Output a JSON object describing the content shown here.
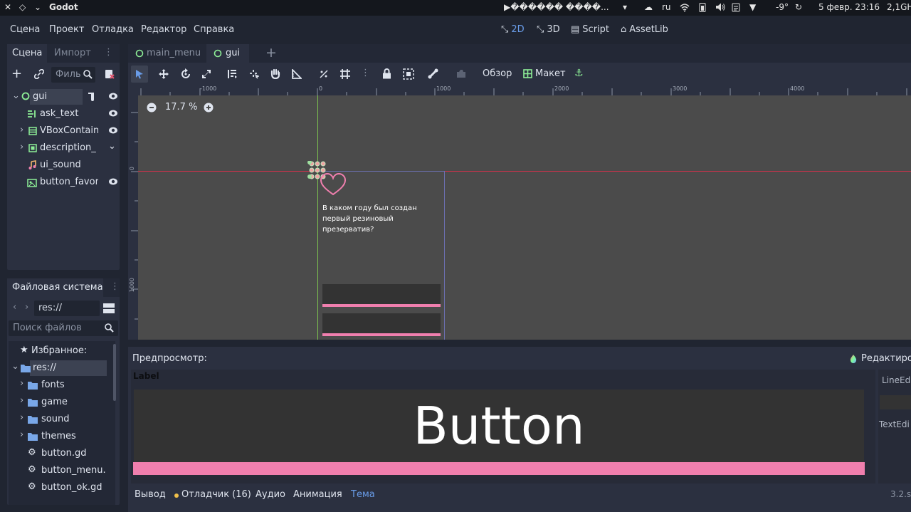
{
  "sysbar": {
    "app_name": "Godot",
    "player_text": "▶������ ����...",
    "lang": "ru",
    "temp": "-9°",
    "datetime": "5 февр. 23:16",
    "cpu": "2,1GH"
  },
  "menu": {
    "items": [
      "Сцена",
      "Проект",
      "Отладка",
      "Редактор",
      "Справка"
    ],
    "workspaces": [
      "2D",
      "3D",
      "Script",
      "AssetLib"
    ]
  },
  "scene_dock": {
    "tab_scene": "Сцена",
    "tab_import": "Импорт",
    "filter_placeholder": "Филь",
    "nodes": [
      {
        "label": "gui",
        "icon": "control-node-icon"
      },
      {
        "label": "ask_text",
        "icon": "label-node-icon"
      },
      {
        "label": "VBoxContain",
        "icon": "vbox-icon"
      },
      {
        "label": "description_",
        "icon": "panel-icon"
      },
      {
        "label": "ui_sound",
        "icon": "audio-icon"
      },
      {
        "label": "button_favor",
        "icon": "texture-button-icon"
      }
    ]
  },
  "fs_dock": {
    "title": "Файловая система",
    "path": "res://",
    "search_placeholder": "Поиск файлов",
    "favorites": "Избранное:",
    "root": "res://",
    "items": [
      "fonts",
      "game",
      "sound",
      "themes",
      "button.gd",
      "button_menu.",
      "button_ok.gd"
    ]
  },
  "editor_tabs": [
    "main_menu",
    "gui"
  ],
  "toolbar": {
    "view_label": "Обзор",
    "layout_label": "Макет"
  },
  "canvas": {
    "zoom": "17.7 %",
    "ruler_labels": [
      "-1000",
      "0",
      "1000",
      "2000",
      "3000",
      "4000"
    ],
    "ruler_left_labels": [
      "0",
      "1000"
    ],
    "question": "В каком году был создан первый резиновый презерватив?"
  },
  "preview": {
    "title": "Предпросмотр:",
    "edit_label": "Редактиров",
    "label_text": "Label",
    "button_text": "Button",
    "line_edit": "LineEd",
    "text_edit": "TextEdi"
  },
  "bottom_tabs": [
    "Вывод",
    "Отладчик (16)",
    "Аудио",
    "Анимация",
    "Тема"
  ],
  "version": "3.2.s",
  "colors": {
    "accent": "#699ce8",
    "pink": "#f07fae",
    "green_guide": "#7ec850",
    "red_guide": "#d0314b"
  }
}
